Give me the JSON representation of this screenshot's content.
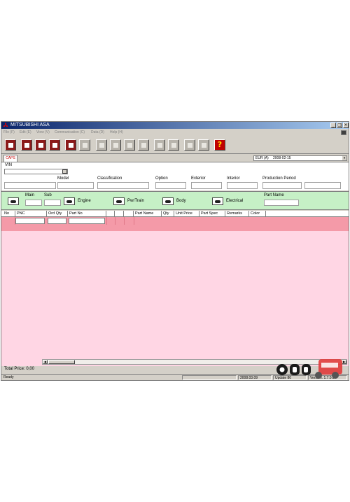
{
  "window": {
    "title": "MITSUBISHI ASA",
    "controls": {
      "minimize": "_",
      "maximize": "□",
      "close": "×"
    }
  },
  "menu": [
    {
      "label": "File (F)"
    },
    {
      "label": "Edit (E)"
    },
    {
      "label": "View (V)"
    },
    {
      "label": "Communication (C)"
    },
    {
      "label": "Data (D)"
    },
    {
      "label": "Help (H)"
    }
  ],
  "toolbar": {
    "help_label": "?"
  },
  "tabs": {
    "active": "CAPS"
  },
  "region": {
    "value": "EUR (A)",
    "date": "2008-02-15",
    "arrow": "▼"
  },
  "vin_panel": {
    "vin_label": "VIN",
    "vin_value": "",
    "labels": {
      "model": "Model",
      "classification": "Classification",
      "option": "Option",
      "exterior": "Exterior",
      "interior": "Interior",
      "production_period": "Production Period"
    }
  },
  "categories": {
    "main_label": "Main",
    "sub_label": "Sub",
    "engine": "Engine",
    "pwrtrain": "PwrTrain",
    "body": "Body",
    "electrical": "Electrical",
    "part_name_label": "Part Name"
  },
  "grid": {
    "columns": [
      "No",
      "PNC",
      "Ord Qty",
      "Part No",
      "",
      "",
      "",
      "Part Name",
      "Qty",
      "Unit Price",
      "Part Spec",
      "Remarks",
      "Color"
    ],
    "rows": []
  },
  "total_price": "Total Price: 0,00",
  "status": {
    "ready": "Ready",
    "date": "2008.03.09",
    "update": "Update 80",
    "version": "Version. 1.7.0.0"
  },
  "colors": {
    "titlebar": "#0a246a",
    "category_bar": "#c6f0c6",
    "grid_background": "#ffd6e4",
    "grid_selected_row": "#f49aa8",
    "help_button": "#c00000"
  }
}
